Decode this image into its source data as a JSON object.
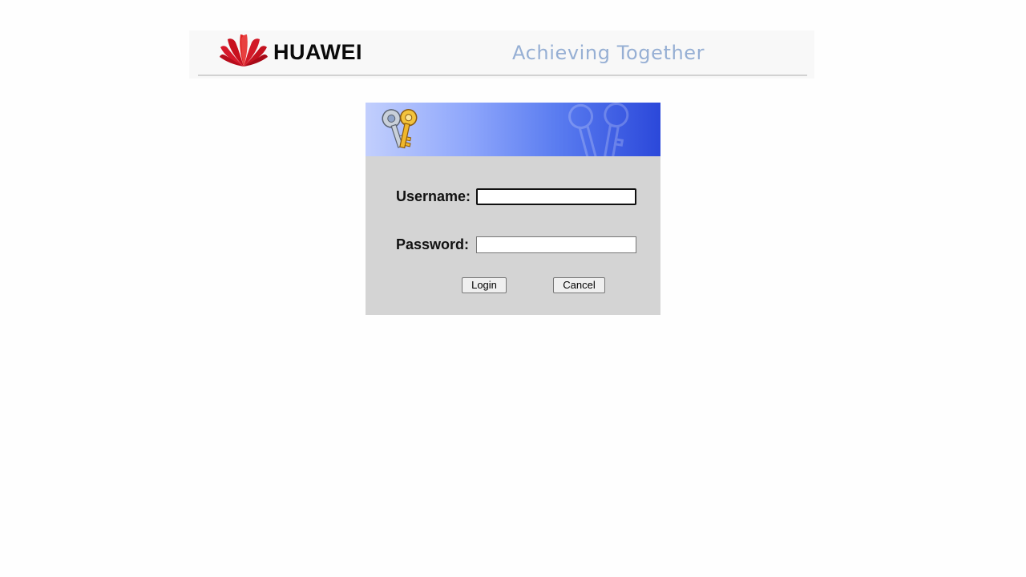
{
  "header": {
    "brand": "HUAWEI",
    "slogan": "Achieving Together",
    "logo_icon": "huawei-petal-logo-icon"
  },
  "banner": {
    "icon": "keys-icon",
    "watermark_icon": "keys-watermark-icon"
  },
  "login": {
    "username_label": "Username:",
    "username_value": "",
    "password_label": "Password:",
    "password_value": "",
    "login_button": "Login",
    "cancel_button": "Cancel"
  },
  "colors": {
    "brand_red": "#d4001a",
    "slogan": "#96afd4",
    "panel_bg": "#d4d4d4",
    "banner_dark": "#2b48da"
  }
}
